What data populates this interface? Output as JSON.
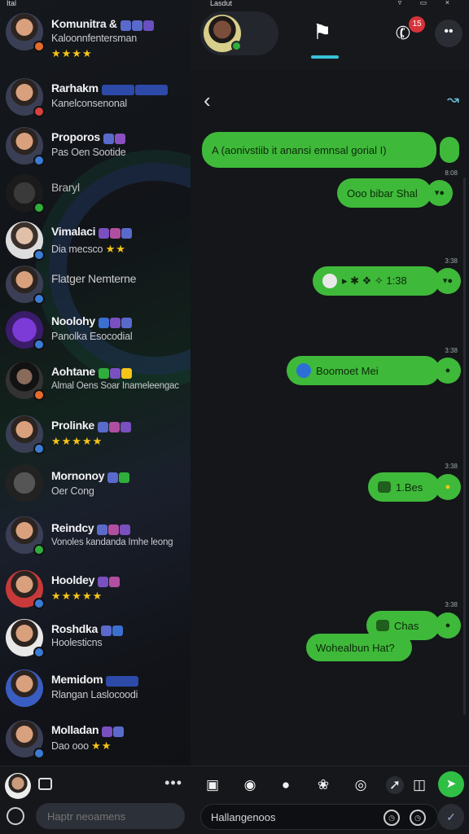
{
  "status": {
    "left": "Ital",
    "center": "Lasdut",
    "right": "▿ ▭ ×"
  },
  "contacts": [
    {
      "name": "Komunitra &",
      "sub": "Kaloonnfentersman",
      "badge": "#e66b2a"
    },
    {
      "name": "Rarhakm",
      "sub": "Kanelconsenonal",
      "badge": "#d94040"
    },
    {
      "name": "Proporos",
      "sub": "Pas Oen Sootide",
      "badge": "#3a7bd5"
    },
    {
      "name": "Braryl",
      "sub": "",
      "badge": "#2fae3c"
    },
    {
      "name": "Vimalaci",
      "sub": "Dia mecsco",
      "badge": "#3a7bd5"
    },
    {
      "name": "Flatger Nemterne",
      "sub": "",
      "badge": "#3a7bd5"
    },
    {
      "name": "Noolohy",
      "sub": "Panolka Esocodial",
      "badge": "#3a7bd5"
    },
    {
      "name": "Aohtane",
      "sub": "Almal Oens Soar Inameleengac",
      "badge": "#e66b2a"
    },
    {
      "name": "Prolinke",
      "sub": "",
      "badge": "#3a7bd5"
    },
    {
      "name": "Mornonoy",
      "sub": "Oer Cong",
      "badge": "#2fae3c"
    },
    {
      "name": "Reindcy",
      "sub": "Vonoles kandanda Imhe leong",
      "badge": "#2fae3c"
    },
    {
      "name": "Hooldey",
      "sub": "",
      "badge": "#3a7bd5"
    },
    {
      "name": "Roshdka",
      "sub": "Hoolesticns",
      "badge": "#3a7bd5"
    },
    {
      "name": "Memidom",
      "sub": "Rlangan Laslocoodi",
      "badge": "#3a7bd5"
    },
    {
      "name": "Molladan",
      "sub": "Dao ooo",
      "badge": "#3a7bd5"
    }
  ],
  "left_search": {
    "placeholder": "Haptr neoamens"
  },
  "messages": [
    {
      "text": "A (aonivstiib it anansi emnsal gorial I)",
      "tip": "",
      "stamp": ""
    },
    {
      "text": "Ooo bibar Shal",
      "tip": "▾●",
      "stamp": "8:08"
    },
    {
      "text": "▸ ✱ ❖ ✧ 1:38",
      "tip": "▾●",
      "stamp": "3:38"
    },
    {
      "text": "Boomoet Mei",
      "tip": "●",
      "stamp": "3:38"
    },
    {
      "text": "1.Bes",
      "tip": "●",
      "stamp": "3:38"
    },
    {
      "text": "Chas",
      "tip": "●",
      "stamp": "3:38"
    },
    {
      "text": "Wohealbun Hat?",
      "tip": "",
      "stamp": ""
    }
  ],
  "composer": {
    "placeholder": "Hallangenoos"
  },
  "call_badge": "15",
  "colors": {
    "bubble": "#3fb93a",
    "accent": "#38c2d8",
    "send": "#2fbf45"
  }
}
